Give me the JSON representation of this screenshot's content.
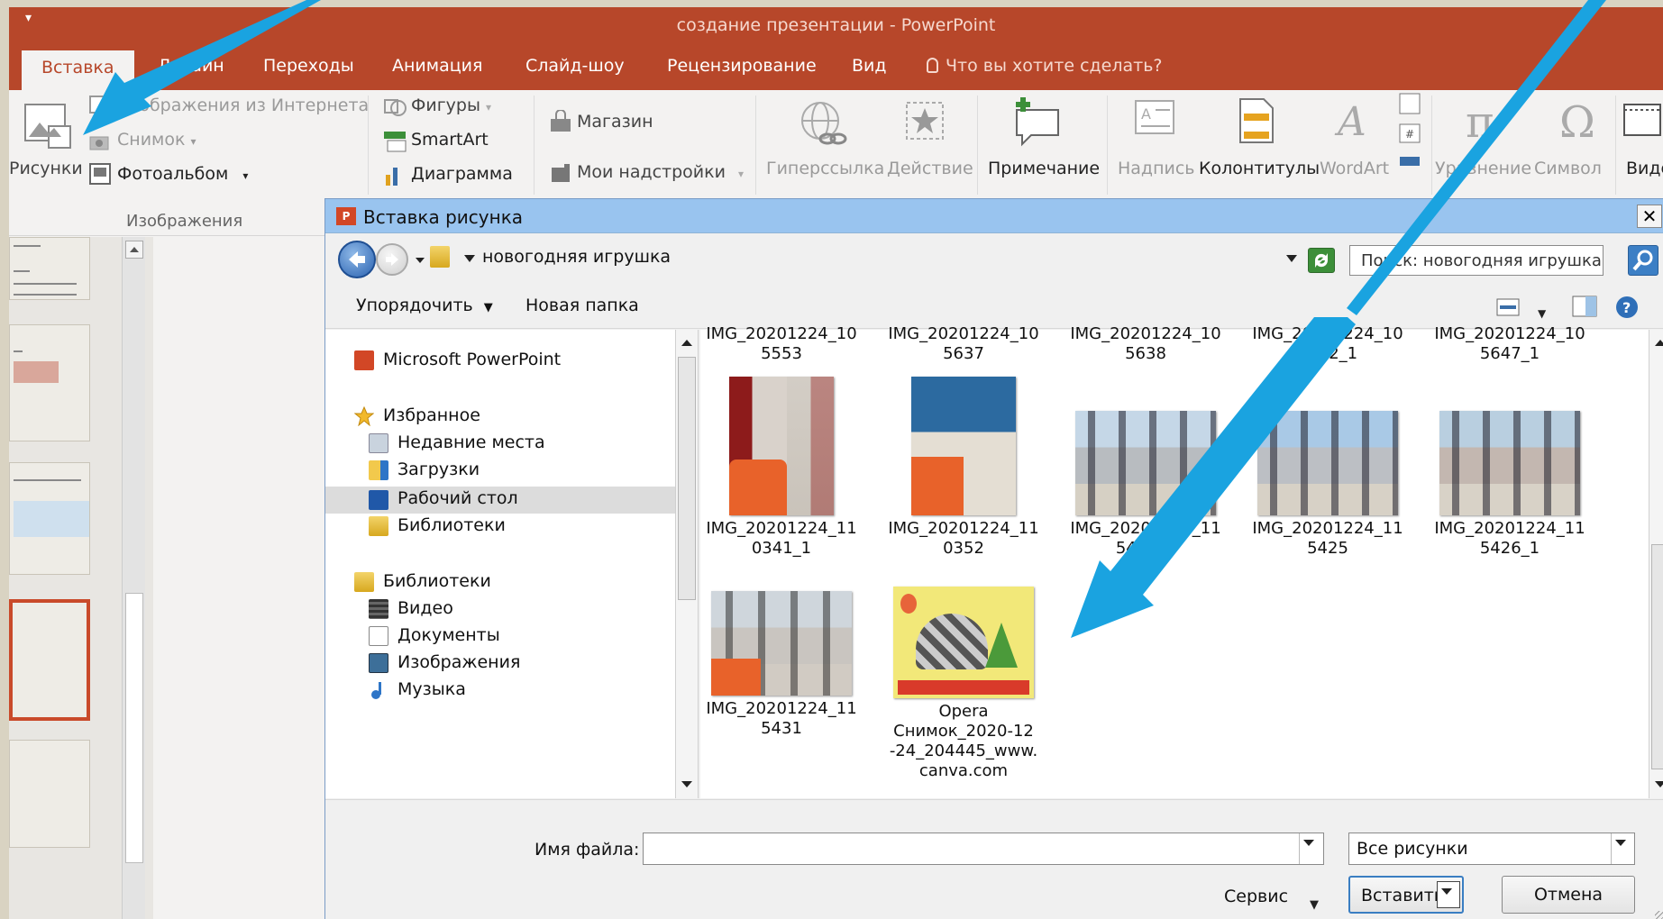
{
  "window": {
    "title": "создание презентации - PowerPoint",
    "qat_glyph": "▾"
  },
  "tabs": [
    {
      "label": "Вставка"
    },
    {
      "label": "Дизайн"
    },
    {
      "label": "Переходы"
    },
    {
      "label": "Анимация"
    },
    {
      "label": "Слайд-шоу"
    },
    {
      "label": "Рецензирование"
    },
    {
      "label": "Вид"
    }
  ],
  "tellme": "Что вы хотите сделать?",
  "ribbon": {
    "pictures": "Рисунки",
    "online_images": "Изображения из Интернета",
    "screenshot": "Снимок",
    "photo_album": "Фотоальбом",
    "images_group": "Изображения",
    "shapes": "Фигуры",
    "smartart": "SmartArt",
    "chart": "Диаграмма",
    "store": "Магазин",
    "my_addins": "Мои надстройки",
    "hyperlink": "Гиперссылка",
    "action": "Действие",
    "comment": "Примечание",
    "textbox": "Надпись",
    "header_footer": "Колонтитулы",
    "wordart": "WordArt",
    "equation": "Уравнение",
    "symbol": "Символ",
    "video": "Виде"
  },
  "dialog": {
    "title": "Вставка рисунка",
    "close": "✕",
    "path": "новогодняя игрушка",
    "search_placeholder": "Поиск: новогодняя игрушка",
    "organize": "Упорядочить",
    "new_folder": "Новая папка"
  },
  "tree": [
    {
      "label": "Microsoft PowerPoint",
      "icon": "powerpoint-icon"
    },
    {
      "label": "Избранное",
      "icon": "star-icon"
    },
    {
      "label": "Недавние места",
      "icon": "recent-places-icon"
    },
    {
      "label": "Загрузки",
      "icon": "downloads-icon"
    },
    {
      "label": "Рабочий стол",
      "icon": "desktop-icon"
    },
    {
      "label": "Библиотеки",
      "icon": "libraries-icon"
    },
    {
      "label": "Библиотеки",
      "icon": "libraries-icon"
    },
    {
      "label": "Видео",
      "icon": "video-icon"
    },
    {
      "label": "Документы",
      "icon": "documents-icon"
    },
    {
      "label": "Изображения",
      "icon": "pictures-icon"
    },
    {
      "label": "Музыка",
      "icon": "music-icon"
    }
  ],
  "files": [
    {
      "name": "IMG_20201224_10\n5553"
    },
    {
      "name": "IMG_20201224_10\n5637"
    },
    {
      "name": "IMG_20201224_10\n5638"
    },
    {
      "name": "IMG_20201224_10\n5642_1"
    },
    {
      "name": "IMG_20201224_10\n5647_1"
    },
    {
      "name": "IMG_20201224_11\n0341_1"
    },
    {
      "name": "IMG_20201224_11\n0352"
    },
    {
      "name": "IMG_20201224_11\n5418_1"
    },
    {
      "name": "IMG_20201224_11\n5425"
    },
    {
      "name": "IMG_20201224_11\n5426_1"
    },
    {
      "name": "IMG_20201224_11\n5431"
    },
    {
      "name": "Opera\nСнимок_2020-12\n-24_204445_www.\ncanva.com"
    }
  ],
  "bottom": {
    "filename_label": "Имя файла:",
    "filename_value": "",
    "filter": "Все рисунки",
    "service": "Сервис",
    "insert": "Вставить",
    "cancel": "Отмена"
  },
  "colors": {
    "accent": "#b7472a",
    "arrow": "#1aa3e0"
  }
}
